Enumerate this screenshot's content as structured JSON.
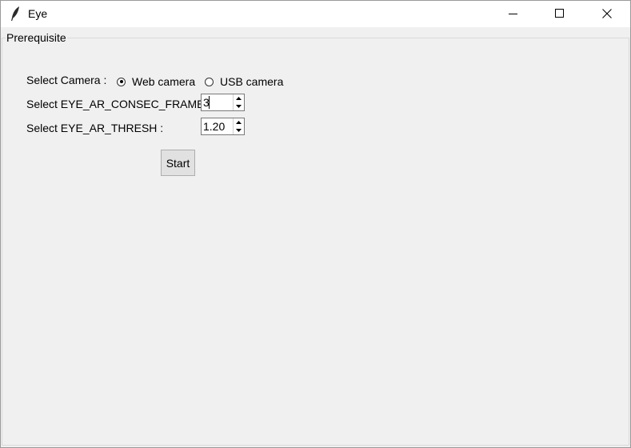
{
  "window": {
    "title": "Eye",
    "icon": "feather-icon"
  },
  "groupbox": {
    "label": "Prerequisite"
  },
  "camera": {
    "label": "Select Camera :",
    "options": [
      {
        "label": "Web camera",
        "checked": true
      },
      {
        "label": "USB camera",
        "checked": false
      }
    ]
  },
  "consec_frames": {
    "label": "Select EYE_AR_CONSEC_FRAMES",
    "value": "3"
  },
  "thresh": {
    "label": "Select EYE_AR_THRESH :",
    "value": "1.20"
  },
  "start_button": {
    "label": "Start"
  }
}
